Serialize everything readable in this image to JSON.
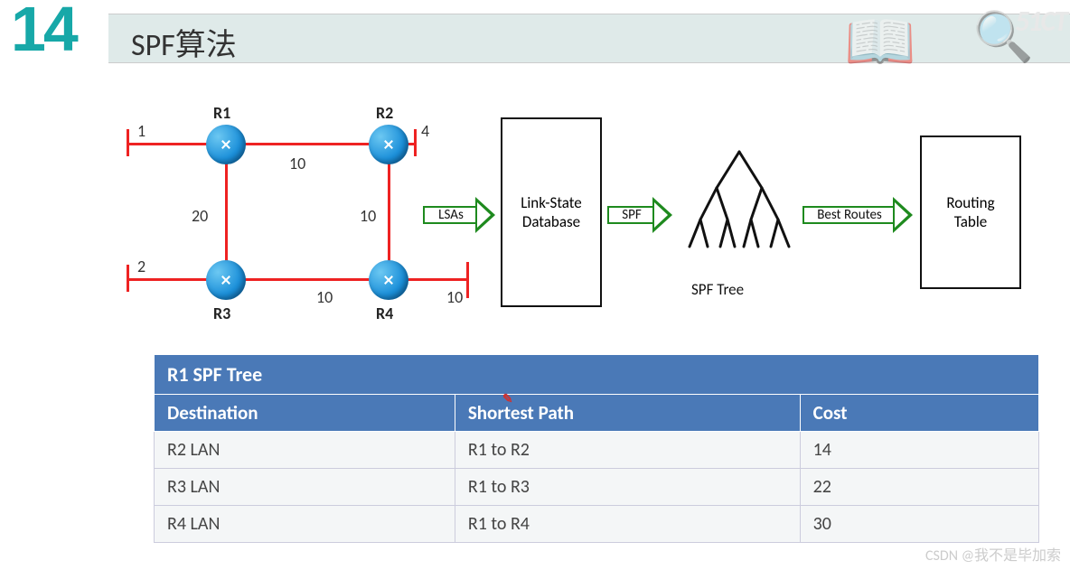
{
  "slide_number": "14",
  "title": "SPF算法",
  "watermarks": {
    "top_right": "51CT",
    "bottom_right": "CSDN @我不是毕加索"
  },
  "topology": {
    "routers": [
      "R1",
      "R2",
      "R3",
      "R4"
    ],
    "link_costs": {
      "R1_lan": "1",
      "R2_lan": "4",
      "R3_lan": "2",
      "R1_R2": "10",
      "R1_R3": "20",
      "R2_R4": "10",
      "R3_R4": "10",
      "R4_lan": "10"
    }
  },
  "flow": {
    "arrow1": "LSAs",
    "box1_line1": "Link-State",
    "box1_line2": "Database",
    "arrow2": "SPF",
    "tree_label": "SPF Tree",
    "arrow3": "Best Routes",
    "box2_line1": "Routing",
    "box2_line2": "Table"
  },
  "table": {
    "title": "R1 SPF Tree",
    "headers": [
      "Destination",
      "Shortest Path",
      "Cost"
    ],
    "rows": [
      [
        "R2 LAN",
        "R1 to R2",
        "14"
      ],
      [
        "R3 LAN",
        "R1 to R3",
        "22"
      ],
      [
        "R4 LAN",
        "R1 to R4",
        "30"
      ]
    ]
  },
  "header_cursor_marker": "✎"
}
